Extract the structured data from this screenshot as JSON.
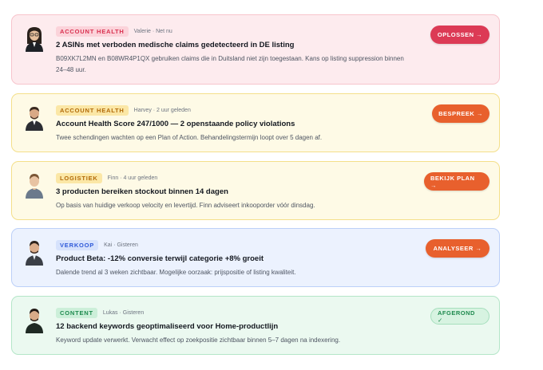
{
  "notifications": [
    {
      "tag": "ACCOUNT HEALTH",
      "meta": "Valerie · Net nu",
      "title": "2 ASINs met verboden medische claims gedetecteerd in DE listing",
      "description": "B09XK7L2MN en B08WR4P1QX gebruiken claims die in Duitsland niet zijn toegestaan. Kans op listing suppression binnen 24–48 uur.",
      "action": "OPLOSSEN →"
    },
    {
      "tag": "ACCOUNT HEALTH",
      "meta": "Harvey · 2 uur geleden",
      "title": "Account Health Score 247/1000 — 2 openstaande policy violations",
      "description": "Twee schendingen wachten op een Plan of Action. Behandelingstermijn loopt over 5 dagen af.",
      "action": "BESPREEK →"
    },
    {
      "tag": "LOGISTIEK",
      "meta": "Finn · 4 uur geleden",
      "title": "3 producten bereiken stockout binnen 14 dagen",
      "description": "Op basis van huidige verkoop velocity en levertijd. Finn adviseert inkooporder vóór dinsdag.",
      "action": "BEKIJK PLAN →"
    },
    {
      "tag": "VERKOOP",
      "meta": "Kai · Gisteren",
      "title": "Product Beta: -12% conversie terwijl categorie +8% groeit",
      "description": "Dalende trend al 3 weken zichtbaar. Mogelijke oorzaak: prijspositie of listing kwaliteit.",
      "action": "ANALYSEER →"
    },
    {
      "tag": "CONTENT",
      "meta": "Lukas · Gisteren",
      "title": "12 backend keywords geoptimaliseerd voor Home-productlijn",
      "description": "Keyword update verwerkt. Verwacht effect op zoekpositie zichtbaar binnen 5–7 dagen na indexering.",
      "action": "AFGEROND ✓"
    }
  ]
}
